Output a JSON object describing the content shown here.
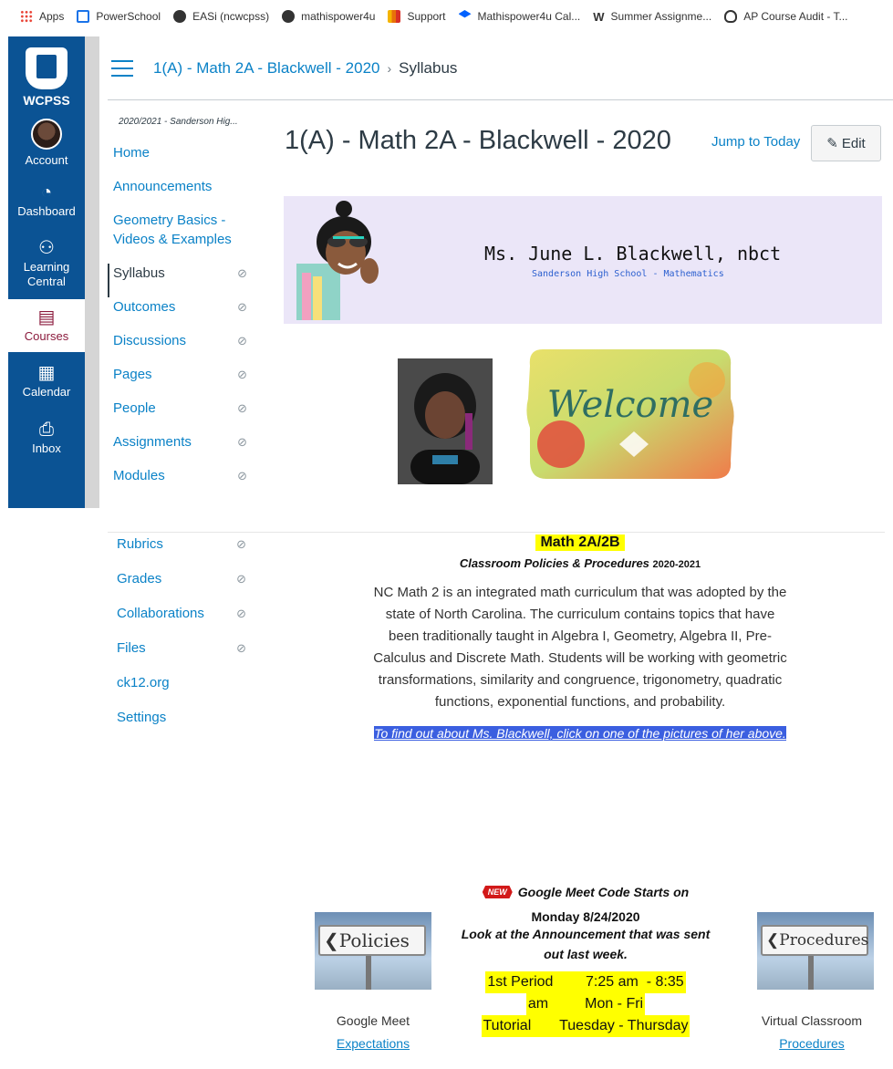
{
  "bookmarks": [
    {
      "label": "Apps",
      "icon": "apps-icon"
    },
    {
      "label": "PowerSchool",
      "icon": "powerschool-icon"
    },
    {
      "label": "EASi (ncwcpss)",
      "icon": "globe-icon"
    },
    {
      "label": "mathispower4u",
      "icon": "globe-icon"
    },
    {
      "label": "Support",
      "icon": "support-icon"
    },
    {
      "label": "Mathispower4u Cal...",
      "icon": "dropbox-icon"
    },
    {
      "label": "Summer Assignme...",
      "icon": "w-icon"
    },
    {
      "label": "AP Course Audit - T...",
      "icon": "ap-icon"
    }
  ],
  "global_nav": {
    "logo_text": "WCPSS",
    "items": [
      {
        "label": "Account",
        "icon": "avatar"
      },
      {
        "label": "Dashboard",
        "icon": "speedometer-icon"
      },
      {
        "label": "Learning Central",
        "icon": "learning-icon"
      },
      {
        "label": "Courses",
        "icon": "book-icon"
      },
      {
        "label": "Calendar",
        "icon": "calendar-icon"
      },
      {
        "label": "Inbox",
        "icon": "inbox-icon"
      }
    ],
    "active": "Courses",
    "active_color": "#8b1a3c",
    "bg_color": "#0b5394"
  },
  "breadcrumb": {
    "course": "1(A) - Math 2A - Blackwell - 2020",
    "current": "Syllabus"
  },
  "course_nav": {
    "term": "2020/2021 - Sanderson Hig...",
    "items": [
      {
        "label": "Home",
        "hidden": false
      },
      {
        "label": "Announcements",
        "hidden": false
      },
      {
        "label": "Geometry Basics - Videos & Examples",
        "hidden": false
      },
      {
        "label": "Syllabus",
        "hidden": true,
        "active": true
      },
      {
        "label": "Outcomes",
        "hidden": true
      },
      {
        "label": "Discussions",
        "hidden": true
      },
      {
        "label": "Pages",
        "hidden": true
      },
      {
        "label": "People",
        "hidden": true
      },
      {
        "label": "Assignments",
        "hidden": true
      },
      {
        "label": "Modules",
        "hidden": true
      }
    ],
    "items_lower": [
      {
        "label": "Rubrics",
        "hidden": true
      },
      {
        "label": "Grades",
        "hidden": true
      },
      {
        "label": "Collaborations",
        "hidden": true
      },
      {
        "label": "Files",
        "hidden": true
      },
      {
        "label": "ck12.org",
        "hidden": false
      },
      {
        "label": "Settings",
        "hidden": false
      }
    ]
  },
  "header": {
    "title": "1(A) - Math 2A - Blackwell - 2020",
    "jump_label": "Jump to Today",
    "edit_label": "Edit"
  },
  "banner": {
    "name": "Ms. June L. Blackwell, nbct",
    "school": "Sanderson High School - Mathematics"
  },
  "content": {
    "course_title": "Math 2A/2B",
    "policies": "Classroom Policies & Procedures",
    "policies_year": "2020-2021",
    "paragraph": "NC Math 2 is an integrated math curriculum that was adopted by the state of North Carolina.  The curriculum contains topics that have been traditionally taught in Algebra I, Geometry, Algebra II, Pre-Calculus and Discrete Math.  Students will be working with geometric transformations, similarity and congruence, trigonometry, quadratic functions, exponential functions, and probability.",
    "link_text": "To find out about Ms. Blackwell, click on one of the pictures of her above."
  },
  "meet": {
    "badge": "NEW",
    "line1": "Google Meet Code Starts on",
    "line2": "Monday 8/24/2020",
    "line3": "Look at the Announcement that was sent out last week.",
    "schedule": [
      "1st Period        7:25 am  - 8:35",
      "am         Mon - Fri",
      "Tutorial       Tuesday - Thursday"
    ]
  },
  "left_sign": {
    "board_text": "Policies",
    "caption": "Google Meet",
    "link": "Expectations"
  },
  "right_sign": {
    "board_text": "Procedures",
    "caption": "Virtual Classroom",
    "link": "Procedures"
  },
  "welcome_text": "Welcome"
}
